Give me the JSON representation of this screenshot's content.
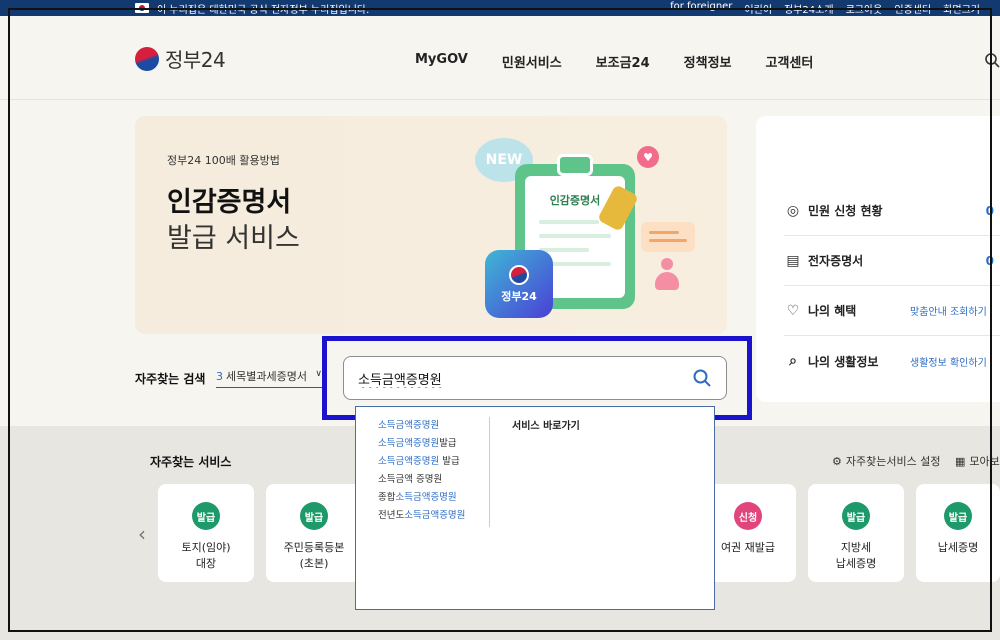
{
  "topbar": {
    "notice": "이 누리집은 대한민국 공식 전자정부 누리집입니다.",
    "links": [
      "for foreigner",
      "어린이",
      "정부24소개",
      "로그아웃",
      "인증센터",
      "화면크기"
    ]
  },
  "header": {
    "logo_text": "정부24",
    "nav": [
      "MyGOV",
      "민원서비스",
      "보조금24",
      "정책정보",
      "고객센터"
    ]
  },
  "banner": {
    "small": "정부24 100배 활용방법",
    "title1": "인감증명서",
    "title2": "발급 서비스",
    "new_badge": "NEW",
    "clip_title": "인감증명서",
    "app_label": "정부24"
  },
  "side_panel": {
    "rows": [
      {
        "label": "민원 신청 현황",
        "value": "0",
        "icon": "person-circle-icon"
      },
      {
        "label": "전자증명서",
        "value": "0",
        "icon": "document-icon"
      },
      {
        "label": "나의 혜택",
        "link": "맞춤안내 조회하기",
        "icon": "heart-icon"
      },
      {
        "label": "나의 생활정보",
        "link": "생활정보 확인하기",
        "icon": "search-doc-icon"
      }
    ]
  },
  "frequent_search": {
    "label": "자주찾는 검색",
    "selected_num": "3",
    "selected_text": "세목별과세증명서"
  },
  "search": {
    "value": "소득금액증명원"
  },
  "autocomplete": {
    "suggestions": [
      {
        "pre": "",
        "hl": "소득금액증명원",
        "post": ""
      },
      {
        "pre": "",
        "hl": "소득금액증명원",
        "post": "발급"
      },
      {
        "pre": "",
        "hl": "소득금액증명원",
        "post": " 발급"
      },
      {
        "pre": "소득금액 증명원",
        "hl": "",
        "post": ""
      },
      {
        "pre": "종합",
        "hl": "소득금액증명원",
        "post": ""
      },
      {
        "pre": "전년도",
        "hl": "소득금액증명원",
        "post": ""
      }
    ],
    "shortcut_title": "서비스 바로가기"
  },
  "frequent_services": {
    "title": "자주찾는 서비스",
    "settings": "자주찾는서비스 설정",
    "view_all": "모아보",
    "cards": [
      {
        "badge": "발급",
        "name": "토지(임야)\n대장",
        "pink": false
      },
      {
        "badge": "발급",
        "name": "주민등록등본\n(초본)",
        "pink": false
      },
      {
        "badge": "신청",
        "name": "여권 재발급",
        "pink": true
      },
      {
        "badge": "발급",
        "name": "지방세\n납세증명",
        "pink": false
      },
      {
        "badge": "발급",
        "name": "납세증명",
        "pink": false
      }
    ]
  }
}
